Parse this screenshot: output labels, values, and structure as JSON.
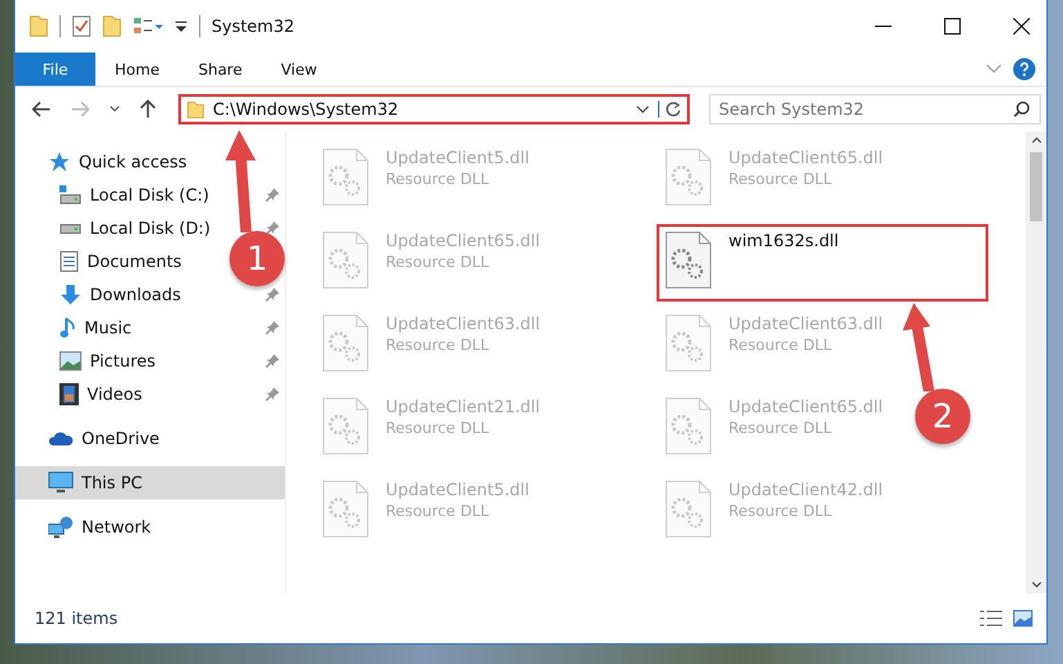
{
  "window": {
    "title": "System32"
  },
  "ribbon": {
    "file_button": "File",
    "tabs": [
      {
        "label": "Home"
      },
      {
        "label": "Share"
      },
      {
        "label": "View"
      }
    ]
  },
  "address_bar": {
    "path": "C:\\Windows\\System32",
    "highlighted": true
  },
  "search": {
    "placeholder": "Search System32"
  },
  "sidebar": {
    "items": [
      {
        "label": "Quick access",
        "kind": "star",
        "pinned": false,
        "selected": false,
        "children": [
          {
            "label": "Local Disk (C:)",
            "kind": "drive-win",
            "pinned": true,
            "selected": false
          },
          {
            "label": "Local Disk (D:)",
            "kind": "drive",
            "pinned": true,
            "selected": false
          },
          {
            "label": "Documents",
            "kind": "documents",
            "pinned": false,
            "selected": false
          },
          {
            "label": "Downloads",
            "kind": "downloads",
            "pinned": true,
            "selected": false
          },
          {
            "label": "Music",
            "kind": "music",
            "pinned": true,
            "selected": false
          },
          {
            "label": "Pictures",
            "kind": "pictures",
            "pinned": true,
            "selected": false
          },
          {
            "label": "Videos",
            "kind": "videos",
            "pinned": true,
            "selected": false
          }
        ]
      },
      {
        "label": "OneDrive",
        "kind": "cloud",
        "pinned": false,
        "selected": false
      },
      {
        "label": "This PC",
        "kind": "pc",
        "pinned": false,
        "selected": true
      },
      {
        "label": "Network",
        "kind": "network",
        "pinned": false,
        "selected": false
      }
    ]
  },
  "files": [
    {
      "name": "UpdateClient5.dll",
      "type": "Resource DLL",
      "blurred": true,
      "highlighted": false
    },
    {
      "name": "UpdateClient65.dll",
      "type": "Resource DLL",
      "blurred": true,
      "highlighted": false
    },
    {
      "name": "UpdateClient65.dll",
      "type": "Resource DLL",
      "blurred": true,
      "highlighted": false
    },
    {
      "name": "wim1632s.dll",
      "blurred": false,
      "highlighted": true
    },
    {
      "name": "UpdateClient63.dll",
      "type": "Resource DLL",
      "blurred": true,
      "highlighted": false
    },
    {
      "name": "UpdateClient63.dll",
      "type": "Resource DLL",
      "blurred": true,
      "highlighted": false
    },
    {
      "name": "UpdateClient21.dll",
      "type": "Resource DLL",
      "blurred": true,
      "highlighted": false
    },
    {
      "name": "UpdateClient65.dll",
      "type": "Resource DLL",
      "blurred": true,
      "highlighted": false
    },
    {
      "name": "UpdateClient5.dll",
      "type": "Resource DLL",
      "blurred": true,
      "highlighted": false
    },
    {
      "name": "UpdateClient42.dll",
      "type": "Resource DLL",
      "blurred": true,
      "highlighted": false
    }
  ],
  "annotations": [
    {
      "number": "1"
    },
    {
      "number": "2"
    }
  ],
  "status_bar": {
    "item_count": "121 items"
  }
}
